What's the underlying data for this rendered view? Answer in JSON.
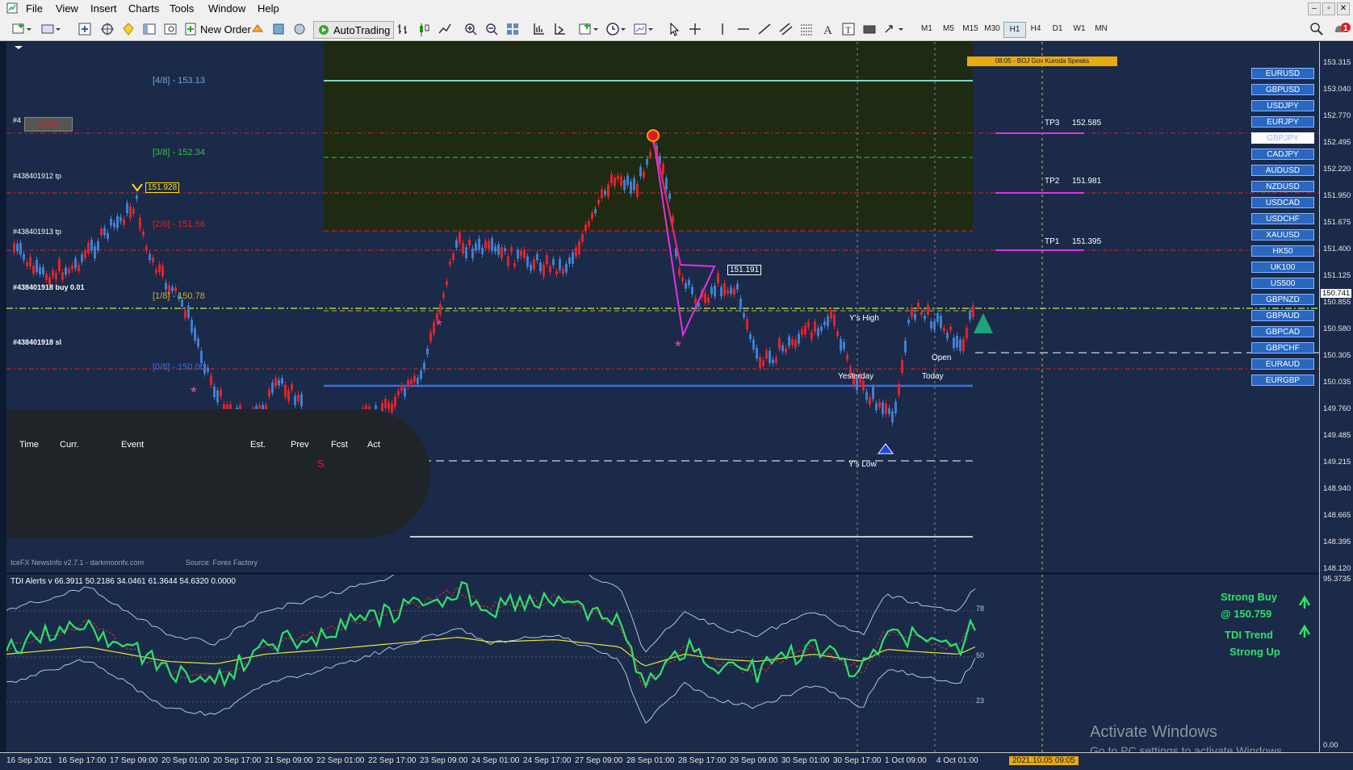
{
  "menu": [
    "File",
    "View",
    "Insert",
    "Charts",
    "Tools",
    "Window",
    "Help"
  ],
  "toolbar": {
    "new_order": "New Order",
    "autotrading": "AutoTrading",
    "timeframes": [
      "M1",
      "M5",
      "M15",
      "M30",
      "H1",
      "H4",
      "D1",
      "W1",
      "MN"
    ],
    "selected_timeframe": "H1",
    "notification_count": "1"
  },
  "price_axis": [
    "153.315",
    "153.040",
    "152.770",
    "152.495",
    "152.220",
    "151.950",
    "151.675",
    "151.400",
    "151.125",
    "150.855",
    "150.580",
    "150.305",
    "150.035",
    "149.760",
    "149.485",
    "149.215",
    "148.940",
    "148.665",
    "148.395",
    "148.120"
  ],
  "current_price_box": "150.741",
  "indicator_axis": [
    "95.3735",
    "78",
    "50",
    "23",
    "0.00"
  ],
  "time_axis": [
    "16 Sep 2021",
    "16 Sep 17:00",
    "17 Sep 09:00",
    "20 Sep 01:00",
    "20 Sep 17:00",
    "21 Sep 09:00",
    "22 Sep 01:00",
    "22 Sep 17:00",
    "23 Sep 09:00",
    "24 Sep 01:00",
    "24 Sep 17:00",
    "27 Sep 09:00",
    "28 Sep 01:00",
    "28 Sep 17:00",
    "29 Sep 09:00",
    "30 Sep 01:00",
    "30 Sep 17:00",
    "1 Oct 09:00",
    "4 Oct 01:00"
  ],
  "time_cursor": "2021.10.05 09:05",
  "levels": {
    "l48": "[4/8] - 153.13",
    "l38": "[3/8] - 152.34",
    "l28": "[2/8] - 151.56",
    "l18": "[1/8] - 150.78",
    "l08": "[0/8] - 150.00"
  },
  "order_labels": {
    "tp1": "#438401912 tp",
    "tp2": "#438401913 tp",
    "buy": "#438401918 buy 0.01",
    "sl": "#438401918 sl",
    "top": "#4"
  },
  "atr_label": "ATR",
  "price_tags": {
    "high_tag": "151.928",
    "mid_tag": "151.191"
  },
  "targets": {
    "tp3_label": "TP3",
    "tp3_value": "152.585",
    "tp2_label": "TP2",
    "tp2_value": "151.981",
    "tp1_label": "TP1",
    "tp1_value": "151.395"
  },
  "annotations": {
    "ys_high": "Y's High",
    "yesterday": "Yesterday",
    "open": "Open",
    "today": "Today",
    "ys_low": "Y's Low"
  },
  "news_banner": "08:05 - BOJ Gov Kuroda Speaks",
  "news_panel": {
    "headers": [
      "Time",
      "Curr.",
      "Event",
      "Est.",
      "Prev",
      "Fcst",
      "Act"
    ],
    "s_marker": "S",
    "footer_left": "IceFX NewsInfo v2.7.1  -  darkmoonfx.com",
    "footer_right": "Source: Forex Factory"
  },
  "symbols": [
    "EURUSD",
    "GBPUSD",
    "USDJPY",
    "EURJPY",
    "GBPJPY",
    "CADJPY",
    "AUDUSD",
    "NZDUSD",
    "USDCAD",
    "USDCHF",
    "XAUUSD",
    "HK50",
    "UK100",
    "US500",
    "GBPNZD",
    "GBPAUD",
    "GBPCAD",
    "GBPCHF",
    "EURAUD",
    "EURGBP"
  ],
  "selected_symbol": "GBPJPY",
  "tdi": {
    "title": "TDI Alerts v 66.3911 50.2186 34.0461 61.3644 54.6320 0.0000",
    "signal1": "Strong Buy",
    "signal2": "@ 150.759",
    "trend1": "TDI Trend",
    "trend2": "Strong Up"
  },
  "watermark": {
    "line1": "Activate Windows",
    "line2": "Go to PC settings to activate Windows."
  },
  "colors": {
    "chart_bg": "#1b2a48",
    "bull": "#3f7fd1",
    "bear": "#e0232b",
    "tdi_green": "#2de36a",
    "tdi_yellow": "#e6e63a",
    "band": "#a9c6e8"
  }
}
